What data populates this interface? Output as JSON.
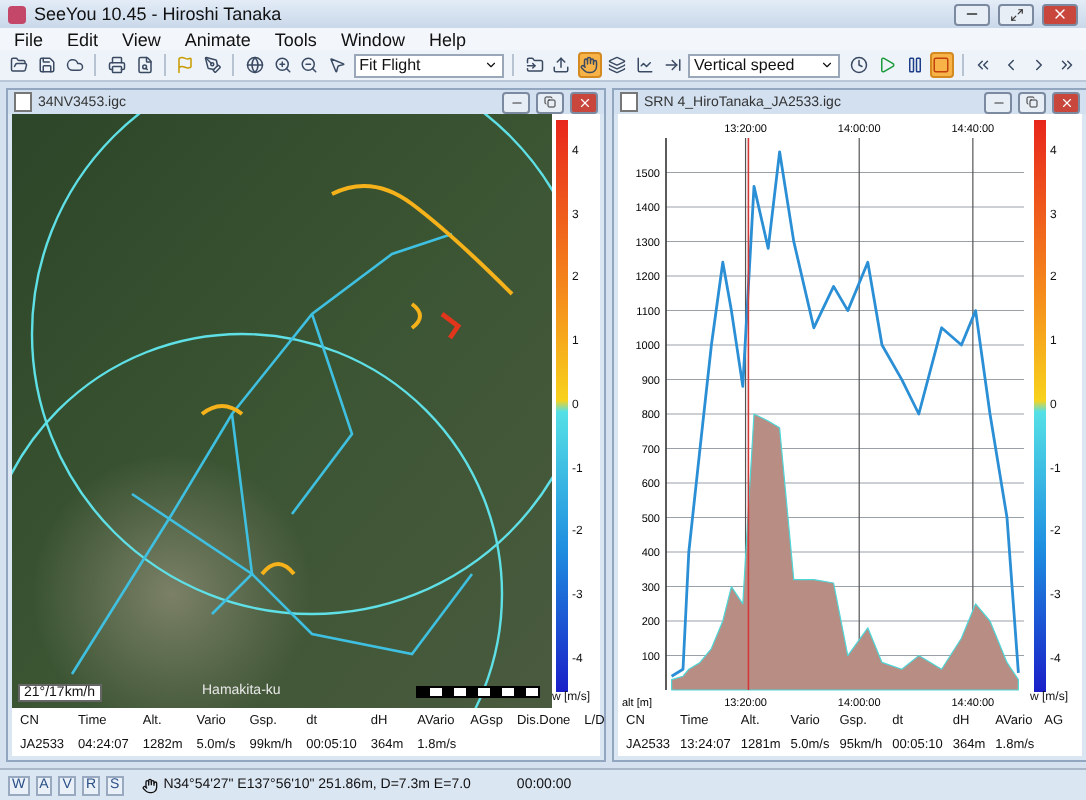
{
  "window": {
    "title": "SeeYou 10.45 - Hiroshi Tanaka"
  },
  "menu": [
    "File",
    "Edit",
    "View",
    "Animate",
    "Tools",
    "Window",
    "Help"
  ],
  "toolbar": [
    {
      "kind": "tool",
      "active": false
    },
    {
      "kind": "tool",
      "active": false
    },
    {
      "kind": "tool",
      "active": false
    },
    {
      "kind": "sep"
    },
    {
      "kind": "tool",
      "active": false
    },
    {
      "kind": "tool",
      "active": false
    },
    {
      "kind": "sep"
    },
    {
      "kind": "tool",
      "active": false
    },
    {
      "kind": "tool",
      "active": false
    },
    {
      "kind": "sep"
    },
    {
      "kind": "tool",
      "active": false
    },
    {
      "kind": "tool",
      "active": false
    },
    {
      "kind": "tool",
      "active": false
    },
    {
      "kind": "tool",
      "active": false
    },
    {
      "kind": "select",
      "value": "Fit Flight"
    },
    {
      "kind": "sep"
    },
    {
      "kind": "tool",
      "active": false
    },
    {
      "kind": "tool",
      "active": false
    },
    {
      "kind": "tool",
      "active": true
    },
    {
      "kind": "tool",
      "active": false
    },
    {
      "kind": "tool",
      "active": false
    },
    {
      "kind": "tool",
      "active": false
    },
    {
      "kind": "select",
      "value": "Vertical speed"
    },
    {
      "kind": "gap"
    },
    {
      "kind": "tool",
      "active": false
    },
    {
      "kind": "tool",
      "active": false
    },
    {
      "kind": "tool",
      "active": false
    },
    {
      "kind": "tool",
      "active": true
    },
    {
      "kind": "sep"
    },
    {
      "kind": "tool",
      "active": false
    },
    {
      "kind": "tool",
      "active": false
    },
    {
      "kind": "tool",
      "active": false
    },
    {
      "kind": "tool",
      "active": false
    }
  ],
  "map_window": {
    "title": "34NV3453.igc",
    "place_label": "Hamakita-ku",
    "wind_label": "21°/17km/h",
    "colorbar": {
      "ticks": [
        "4",
        "3",
        "2",
        "1",
        "0",
        "-1",
        "-2",
        "-3",
        "-4"
      ],
      "unit": "w [m/s]"
    },
    "stats": [
      {
        "header": "CN",
        "value": "JA2533"
      },
      {
        "header": "Time",
        "value": "04:24:07"
      },
      {
        "header": "Alt.",
        "value": "1282m"
      },
      {
        "header": "Vario",
        "value": "5.0m/s"
      },
      {
        "header": "Gsp.",
        "value": "99km/h"
      },
      {
        "header": "dt",
        "value": "00:05:10"
      },
      {
        "header": "dH",
        "value": "364m"
      },
      {
        "header": "AVario",
        "value": "1.8m/s"
      },
      {
        "header": "AGsp"
      },
      {
        "header": "Dis.Done"
      },
      {
        "header": "L/D"
      }
    ]
  },
  "graph_window": {
    "title": "SRN 4_HiroTanaka_JA2533.igc",
    "colorbar": {
      "ticks": [
        "4",
        "3",
        "2",
        "1",
        "0",
        "-1",
        "-2",
        "-3",
        "-4"
      ],
      "unit": "w [m/s]"
    },
    "chart_data": {
      "type": "line",
      "ylabel": "alt [m]",
      "x": [
        46440,
        46680,
        46800,
        47040,
        47280,
        47520,
        47700,
        47940,
        48180,
        48480,
        48720,
        49020,
        49440,
        49860,
        50160,
        50580,
        50880,
        51300,
        51660,
        52140,
        52560,
        52860,
        53160,
        53520,
        53760
      ],
      "series": [
        {
          "type": "line",
          "color": "#2b8fd6",
          "values": [
            40,
            60,
            400,
            700,
            1000,
            1240,
            1100,
            880,
            1460,
            1280,
            1560,
            1300,
            1050,
            1170,
            1100,
            1240,
            1000,
            900,
            800,
            1050,
            1000,
            1100,
            800,
            500,
            50
          ]
        },
        {
          "type": "area",
          "color": "#b78d84",
          "values": [
            30,
            40,
            60,
            80,
            120,
            200,
            300,
            250,
            800,
            780,
            760,
            320,
            320,
            310,
            100,
            180,
            80,
            60,
            100,
            60,
            150,
            250,
            200,
            80,
            30
          ]
        }
      ],
      "xlim": [
        46320,
        53880
      ],
      "ylim": [
        0,
        1600
      ],
      "grid": true,
      "ref_lines": [
        {
          "axis": "x",
          "value": 48060,
          "color": "#d23a3a"
        }
      ],
      "xticks": [
        {
          "value": 48000,
          "label": "13:20:00"
        },
        {
          "value": 50400,
          "label": "14:00:00"
        },
        {
          "value": 52800,
          "label": "14:40:00"
        }
      ],
      "yticks": [
        100,
        200,
        300,
        400,
        500,
        600,
        700,
        800,
        900,
        1000,
        1100,
        1200,
        1300,
        1400,
        1500
      ]
    },
    "stats": [
      {
        "header": "CN",
        "value": "JA2533"
      },
      {
        "header": "Time",
        "value": "13:24:07"
      },
      {
        "header": "Alt.",
        "value": "1281m"
      },
      {
        "header": "Vario",
        "value": "5.0m/s"
      },
      {
        "header": "Gsp.",
        "value": "95km/h"
      },
      {
        "header": "dt",
        "value": "00:05:10"
      },
      {
        "header": "dH",
        "value": "364m"
      },
      {
        "header": "AVario",
        "value": "1.8m/s"
      },
      {
        "header": "AG"
      }
    ]
  },
  "status_bar": {
    "tabs": [
      "W",
      "A",
      "V",
      "R",
      "S"
    ],
    "position": "N34°54'27\" E137°56'10\" 251.86m, D=7.3m E=7.0",
    "time": "00:00:00"
  }
}
